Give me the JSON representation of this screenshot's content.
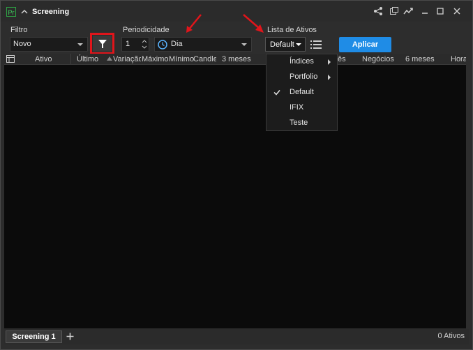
{
  "window": {
    "app_badge": "Pr",
    "title": "Screening",
    "icons": [
      "chevron-up-icon",
      "share-icon",
      "popout-icon",
      "trend-icon",
      "minimize-icon",
      "maximize-icon",
      "close-icon"
    ]
  },
  "filtro": {
    "label": "Filtro",
    "value": "Novo"
  },
  "periodicidade": {
    "label": "Periodicidade",
    "number": "1",
    "period": "Dia"
  },
  "lista_ativos": {
    "label": "Lista de Ativos",
    "value": "Default"
  },
  "buttons": {
    "apply": "Aplicar"
  },
  "columns": [
    "Ativo",
    "Último",
    "Variação",
    "Máximo",
    "Mínimo",
    "Candle",
    "3 meses",
    "ês",
    "Negócios",
    "6 meses",
    "Hora"
  ],
  "menu": {
    "items": [
      {
        "label": "Índices",
        "submenu": true,
        "checked": false
      },
      {
        "label": "Portfolio",
        "submenu": true,
        "checked": false
      },
      {
        "label": "Default",
        "submenu": false,
        "checked": true
      },
      {
        "label": "IFIX",
        "submenu": false,
        "checked": false
      },
      {
        "label": "Teste",
        "submenu": false,
        "checked": false
      }
    ]
  },
  "footer": {
    "tab": "Screening 1",
    "count": "0 Ativos"
  },
  "colors": {
    "accent": "#1f8ce6",
    "highlight": "#e0151b",
    "background": "#2d2d2d",
    "grid": "#0b0b0b"
  }
}
